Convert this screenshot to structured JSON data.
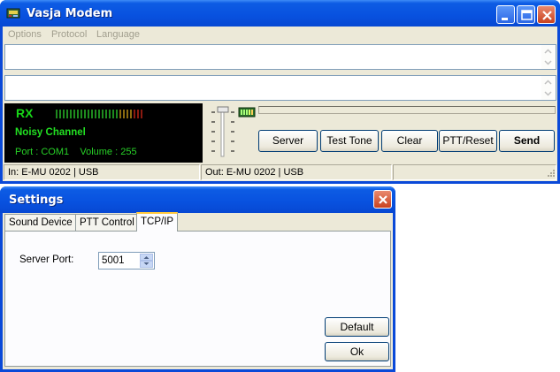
{
  "main_window": {
    "title": "Vasja Modem",
    "menu": [
      "Options",
      "Protocol",
      "Language"
    ],
    "rx_panel": {
      "label": "RX",
      "channel_status": "Noisy Channel",
      "port_line": "Port : COM1    Volume : 255"
    },
    "buttons": {
      "server": "Server",
      "test_tone": "Test Tone",
      "clear": "Clear",
      "ptt_reset": "PTT/Reset",
      "send": "Send"
    },
    "status_bar": {
      "input": "In: E-MU 0202 | USB",
      "output": "Out: E-MU 0202 | USB"
    }
  },
  "settings_dialog": {
    "title": "Settings",
    "tabs": [
      "Sound Device",
      "PTT Control",
      "TCP/IP"
    ],
    "active_tab": "TCP/IP",
    "server_port_label": "Server Port:",
    "server_port_value": "5001",
    "buttons": {
      "default": "Default",
      "ok": "Ok"
    }
  },
  "colors": {
    "titlebar": "#0851df",
    "rx_text": "#17d617",
    "window_face": "#ece9d8"
  }
}
